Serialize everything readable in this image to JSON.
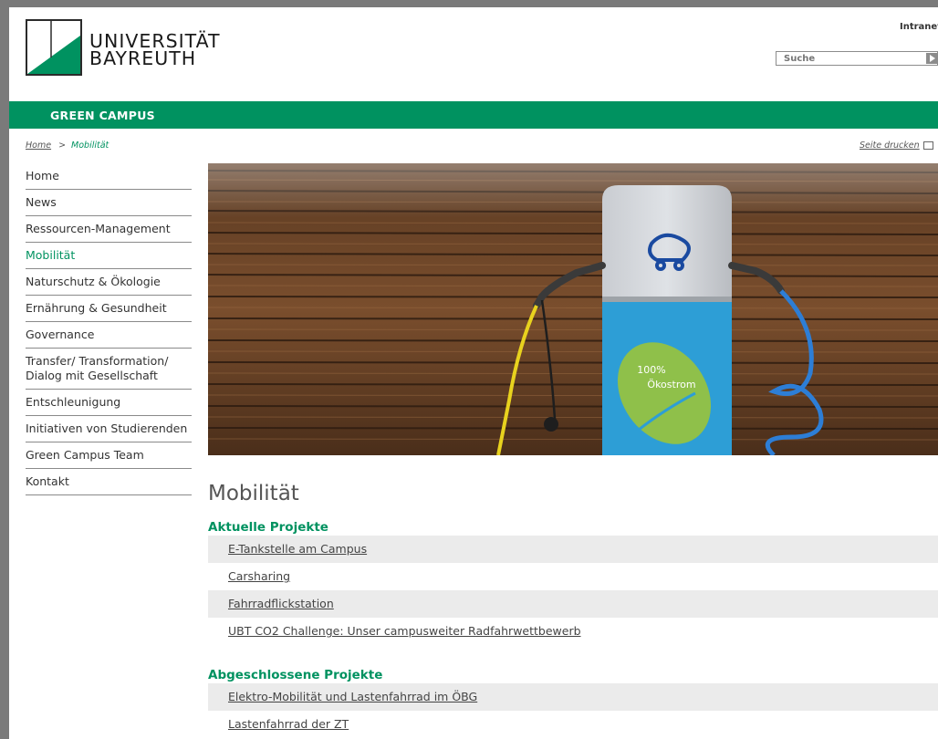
{
  "header": {
    "logo_line1": "UNIVERSITÄT",
    "logo_line2": "BAYREUTH",
    "intranet_label": "Intranet",
    "search_placeholder": "Suche"
  },
  "banner": {
    "title": "GREEN CAMPUS"
  },
  "breadcrumb": {
    "home": "Home",
    "separator": ">",
    "current": "Mobilität"
  },
  "print": {
    "label": "Seite drucken",
    "icon": "printer-icon"
  },
  "sidebar": {
    "items": [
      {
        "label": "Home"
      },
      {
        "label": "News"
      },
      {
        "label": "Ressourcen-Management"
      },
      {
        "label": "Mobilität"
      },
      {
        "label": "Naturschutz & Ökologie"
      },
      {
        "label": "Ernährung & Gesundheit"
      },
      {
        "label": "Governance"
      },
      {
        "label": "Transfer/ Transformation/ Dialog mit Gesellschaft"
      },
      {
        "label": "Entschleunigung"
      },
      {
        "label": "Initiativen von Studierenden"
      },
      {
        "label": "Green Campus Team"
      },
      {
        "label": "Kontakt"
      }
    ],
    "active_item": "Mobilität"
  },
  "hero": {
    "sign_line1": "100%",
    "sign_line2": "Ökostrom"
  },
  "main": {
    "title": "Mobilität",
    "current_projects": {
      "heading": "Aktuelle Projekte",
      "links": [
        "E-Tankstelle am Campus",
        "Carsharing",
        "Fahrradflickstation",
        "UBT CO2 Challenge: Unser campusweiter Radfahrwettbewerb"
      ]
    },
    "completed_projects": {
      "heading": "Abgeschlossene Projekte",
      "links": [
        "Elektro-Mobilität und Lastenfahrrad im ÖBG",
        "Lastenfahrrad der ZT"
      ]
    }
  },
  "colors": {
    "accent": "#009260",
    "frame": "#7a7a7a"
  }
}
